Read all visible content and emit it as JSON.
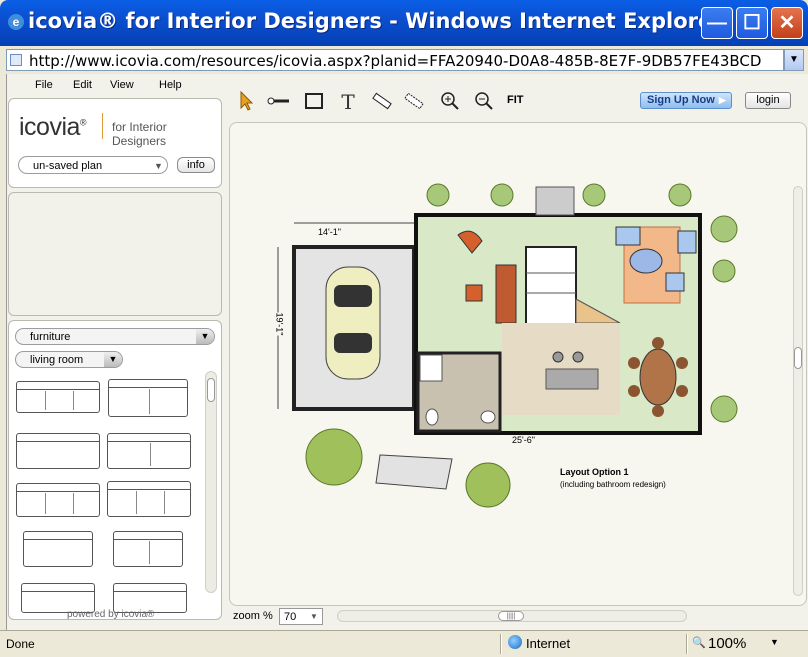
{
  "window": {
    "title": "icovia® for Interior Designers - Windows Internet Explorer",
    "url": "http://www.icovia.com/resources/icovia.aspx?planid=FFA20940-D0A8-485B-8E7F-9DB57FE43BCD",
    "minimize": "—",
    "maximize": "☐",
    "close": "✕"
  },
  "menu": [
    "File",
    "Edit",
    "View",
    "Help"
  ],
  "brand": {
    "name": "icovia",
    "mark": "®",
    "tagline": "for Interior Designers"
  },
  "plan_selector": {
    "value": "un-saved plan"
  },
  "info_button": "info",
  "category": {
    "value": "furniture"
  },
  "subcategory": {
    "value": "living room"
  },
  "powered_by": "powered by icovia®",
  "toolbar": {
    "tools": [
      "select-arrow-icon",
      "wall-tool-icon",
      "room-tool-icon",
      "text-tool-icon",
      "measure-tool-icon",
      "dimension-tool-icon",
      "zoom-in-icon",
      "zoom-out-icon"
    ],
    "text_tool": "T",
    "fit": "FIT",
    "signup": "Sign Up Now",
    "login": "login"
  },
  "plan": {
    "garage_width": "14'-1\"",
    "garage_depth": "19'-1\"",
    "house_width": "25'-6\"",
    "layout_title": "Layout Option 1",
    "layout_subtitle": "(including bathroom redesign)"
  },
  "zoom": {
    "label": "zoom %",
    "value": "70"
  },
  "status": {
    "text": "Done",
    "zone": "Internet",
    "zoom": "100%"
  },
  "colors": {
    "titlebar": "#0a5fe6",
    "living": "#d9e8c7",
    "kitchen": "#e6dcc5",
    "bath": "#c8c1b0",
    "garage": "#e4e4e4",
    "accent": "#e29a3a"
  }
}
